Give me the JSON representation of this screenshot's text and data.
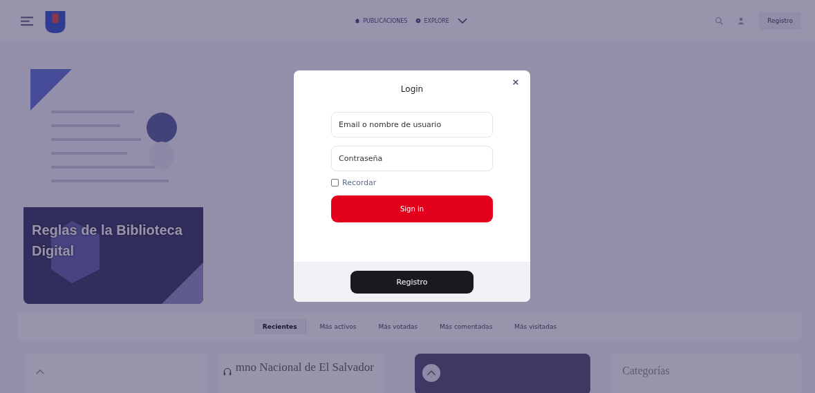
{
  "header": {
    "nav": [
      {
        "kind": "home",
        "label": "PUBLICACIONES"
      },
      {
        "kind": "explore",
        "label": "EXPLORE"
      }
    ],
    "register_button": "Registro"
  },
  "featured": {
    "title": "Reglas de la Biblioteca Digital"
  },
  "tabs": [
    {
      "label": "Recientes",
      "selected": true
    },
    {
      "label": "Más activos",
      "selected": false
    },
    {
      "label": "Más votadas",
      "selected": false
    },
    {
      "label": "Más comentadas",
      "selected": false
    },
    {
      "label": "Más visitadas",
      "selected": false
    }
  ],
  "cards": [
    {
      "kind": "blank"
    },
    {
      "kind": "audio",
      "title": "mno Nacional de El Salvador"
    },
    {
      "kind": "media"
    },
    {
      "kind": "categories",
      "title": "Categorías"
    }
  ],
  "login": {
    "title": "Login",
    "fields": [
      {
        "placeholder": "Email o nombre de usuario"
      },
      {
        "placeholder": "Contraseña"
      }
    ],
    "remember": {
      "label": "Recordar",
      "checked": false
    },
    "submit": "Sign in",
    "register": "Registro"
  }
}
